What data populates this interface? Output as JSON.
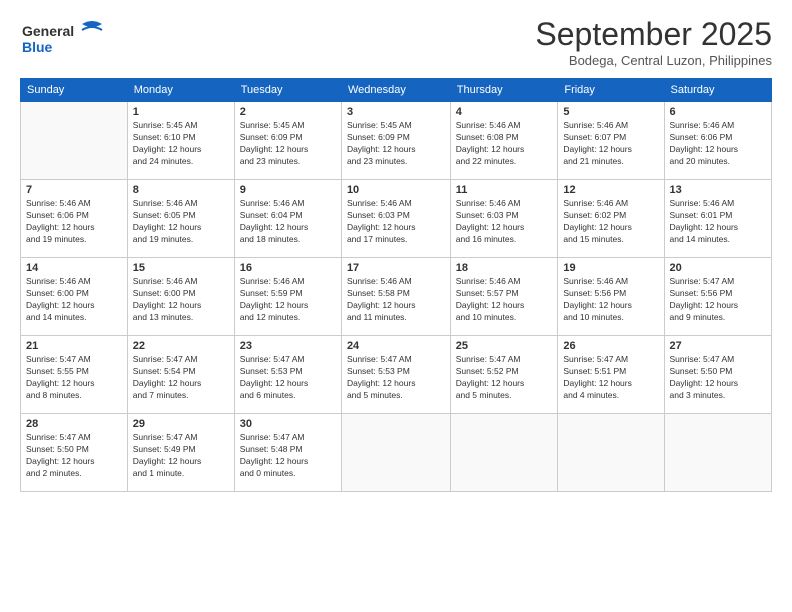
{
  "logo": {
    "general": "General",
    "blue": "Blue"
  },
  "title": "September 2025",
  "location": "Bodega, Central Luzon, Philippines",
  "days_of_week": [
    "Sunday",
    "Monday",
    "Tuesday",
    "Wednesday",
    "Thursday",
    "Friday",
    "Saturday"
  ],
  "weeks": [
    [
      {
        "day": "",
        "info": ""
      },
      {
        "day": "1",
        "info": "Sunrise: 5:45 AM\nSunset: 6:10 PM\nDaylight: 12 hours\nand 24 minutes."
      },
      {
        "day": "2",
        "info": "Sunrise: 5:45 AM\nSunset: 6:09 PM\nDaylight: 12 hours\nand 23 minutes."
      },
      {
        "day": "3",
        "info": "Sunrise: 5:45 AM\nSunset: 6:09 PM\nDaylight: 12 hours\nand 23 minutes."
      },
      {
        "day": "4",
        "info": "Sunrise: 5:46 AM\nSunset: 6:08 PM\nDaylight: 12 hours\nand 22 minutes."
      },
      {
        "day": "5",
        "info": "Sunrise: 5:46 AM\nSunset: 6:07 PM\nDaylight: 12 hours\nand 21 minutes."
      },
      {
        "day": "6",
        "info": "Sunrise: 5:46 AM\nSunset: 6:06 PM\nDaylight: 12 hours\nand 20 minutes."
      }
    ],
    [
      {
        "day": "7",
        "info": "Sunrise: 5:46 AM\nSunset: 6:06 PM\nDaylight: 12 hours\nand 19 minutes."
      },
      {
        "day": "8",
        "info": "Sunrise: 5:46 AM\nSunset: 6:05 PM\nDaylight: 12 hours\nand 19 minutes."
      },
      {
        "day": "9",
        "info": "Sunrise: 5:46 AM\nSunset: 6:04 PM\nDaylight: 12 hours\nand 18 minutes."
      },
      {
        "day": "10",
        "info": "Sunrise: 5:46 AM\nSunset: 6:03 PM\nDaylight: 12 hours\nand 17 minutes."
      },
      {
        "day": "11",
        "info": "Sunrise: 5:46 AM\nSunset: 6:03 PM\nDaylight: 12 hours\nand 16 minutes."
      },
      {
        "day": "12",
        "info": "Sunrise: 5:46 AM\nSunset: 6:02 PM\nDaylight: 12 hours\nand 15 minutes."
      },
      {
        "day": "13",
        "info": "Sunrise: 5:46 AM\nSunset: 6:01 PM\nDaylight: 12 hours\nand 14 minutes."
      }
    ],
    [
      {
        "day": "14",
        "info": "Sunrise: 5:46 AM\nSunset: 6:00 PM\nDaylight: 12 hours\nand 14 minutes."
      },
      {
        "day": "15",
        "info": "Sunrise: 5:46 AM\nSunset: 6:00 PM\nDaylight: 12 hours\nand 13 minutes."
      },
      {
        "day": "16",
        "info": "Sunrise: 5:46 AM\nSunset: 5:59 PM\nDaylight: 12 hours\nand 12 minutes."
      },
      {
        "day": "17",
        "info": "Sunrise: 5:46 AM\nSunset: 5:58 PM\nDaylight: 12 hours\nand 11 minutes."
      },
      {
        "day": "18",
        "info": "Sunrise: 5:46 AM\nSunset: 5:57 PM\nDaylight: 12 hours\nand 10 minutes."
      },
      {
        "day": "19",
        "info": "Sunrise: 5:46 AM\nSunset: 5:56 PM\nDaylight: 12 hours\nand 10 minutes."
      },
      {
        "day": "20",
        "info": "Sunrise: 5:47 AM\nSunset: 5:56 PM\nDaylight: 12 hours\nand 9 minutes."
      }
    ],
    [
      {
        "day": "21",
        "info": "Sunrise: 5:47 AM\nSunset: 5:55 PM\nDaylight: 12 hours\nand 8 minutes."
      },
      {
        "day": "22",
        "info": "Sunrise: 5:47 AM\nSunset: 5:54 PM\nDaylight: 12 hours\nand 7 minutes."
      },
      {
        "day": "23",
        "info": "Sunrise: 5:47 AM\nSunset: 5:53 PM\nDaylight: 12 hours\nand 6 minutes."
      },
      {
        "day": "24",
        "info": "Sunrise: 5:47 AM\nSunset: 5:53 PM\nDaylight: 12 hours\nand 5 minutes."
      },
      {
        "day": "25",
        "info": "Sunrise: 5:47 AM\nSunset: 5:52 PM\nDaylight: 12 hours\nand 5 minutes."
      },
      {
        "day": "26",
        "info": "Sunrise: 5:47 AM\nSunset: 5:51 PM\nDaylight: 12 hours\nand 4 minutes."
      },
      {
        "day": "27",
        "info": "Sunrise: 5:47 AM\nSunset: 5:50 PM\nDaylight: 12 hours\nand 3 minutes."
      }
    ],
    [
      {
        "day": "28",
        "info": "Sunrise: 5:47 AM\nSunset: 5:50 PM\nDaylight: 12 hours\nand 2 minutes."
      },
      {
        "day": "29",
        "info": "Sunrise: 5:47 AM\nSunset: 5:49 PM\nDaylight: 12 hours\nand 1 minute."
      },
      {
        "day": "30",
        "info": "Sunrise: 5:47 AM\nSunset: 5:48 PM\nDaylight: 12 hours\nand 0 minutes."
      },
      {
        "day": "",
        "info": ""
      },
      {
        "day": "",
        "info": ""
      },
      {
        "day": "",
        "info": ""
      },
      {
        "day": "",
        "info": ""
      }
    ]
  ]
}
